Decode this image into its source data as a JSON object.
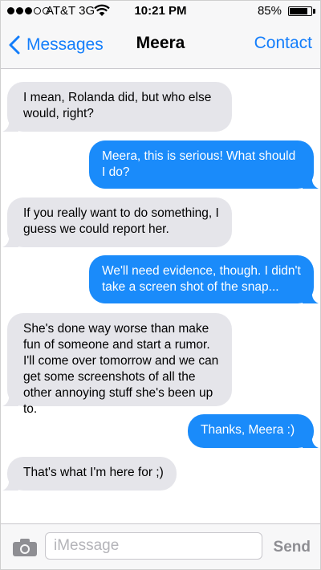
{
  "status_bar": {
    "carrier": "AT&T 3G",
    "time": "10:21 PM",
    "battery": "85%",
    "battery_level": 0.85,
    "signal_bars": 3
  },
  "nav": {
    "back_label": "Messages",
    "title": "Meera",
    "contact_label": "Contact"
  },
  "messages": [
    {
      "sender": "received",
      "text": "I mean, Rolanda did, but who else would, right?"
    },
    {
      "sender": "sent",
      "text": "Meera, this is serious! What should I do?"
    },
    {
      "sender": "received",
      "text": "If you really want to do something, I guess we could report her."
    },
    {
      "sender": "sent",
      "text": "We'll need evidence, though. I didn't take a screen shot of the snap..."
    },
    {
      "sender": "received",
      "text": "She's done way worse than make fun of someone and start a rumor. I'll come over tomorrow and we can get some screenshots of all the other annoying stuff she's been up to."
    },
    {
      "sender": "sent",
      "text": "Thanks, Meera :)"
    },
    {
      "sender": "received",
      "text": "That's what I'm here for ;)"
    }
  ],
  "input_bar": {
    "placeholder": "iMessage",
    "value": "",
    "send_label": "Send"
  },
  "colors": {
    "accent": "#147efb",
    "sent_bubble": "#1a8bfa",
    "received_bubble": "#e5e5ea"
  },
  "icons": [
    "wifi-icon",
    "battery-icon",
    "chevron-left-icon",
    "camera-icon"
  ]
}
